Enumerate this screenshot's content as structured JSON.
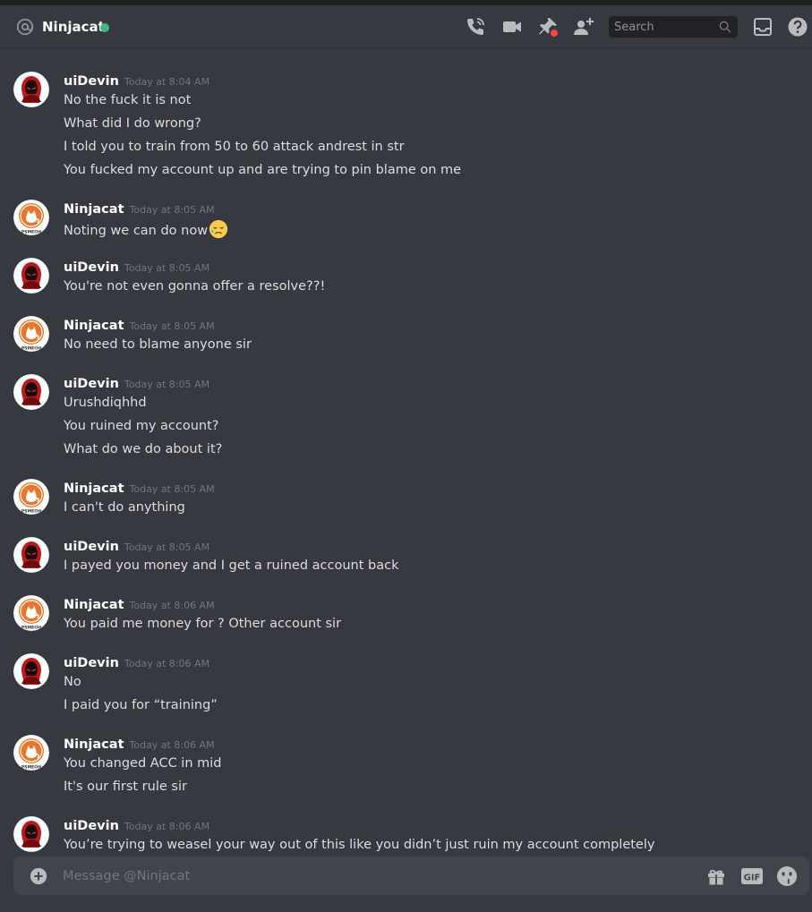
{
  "header": {
    "channel_name": "Ninjacat",
    "status_color": "#43b581",
    "search_placeholder": "Search",
    "icons": [
      "call-icon",
      "video-icon",
      "pin-icon",
      "add-friend-icon",
      "search-icon",
      "inbox-icon",
      "help-icon"
    ]
  },
  "composer": {
    "placeholder": "Message @Ninjacat",
    "icons": [
      "attach-icon",
      "gift-icon",
      "gif-icon",
      "emoji-icon"
    ],
    "gif_label": "GIF"
  },
  "messages": [
    {
      "author": "uiDevin",
      "time": "Today at 8:04 AM",
      "lines": [
        "No the fuck it is not",
        "What did I do wrong?",
        "I told you to train from 50 to 60 attack andrest  in str",
        "You fucked my account up and are trying to pin blame on me"
      ]
    },
    {
      "author": "Ninjacat",
      "time": "Today at 8:05 AM",
      "lines": [
        "Noting we can do now"
      ],
      "emoji": "sad-relieved-face-icon"
    },
    {
      "author": "uiDevin",
      "time": "Today at 8:05 AM",
      "lines": [
        "You're not even gonna offer a resolve??!"
      ]
    },
    {
      "author": "Ninjacat",
      "time": "Today at 8:05 AM",
      "lines": [
        "No need to blame anyone sir"
      ]
    },
    {
      "author": "uiDevin",
      "time": "Today at 8:05 AM",
      "lines": [
        "Urushdiqhhd",
        "You ruined my account?",
        "What do we do about it?"
      ]
    },
    {
      "author": "Ninjacat",
      "time": "Today at 8:05 AM",
      "lines": [
        "I can't do anything"
      ]
    },
    {
      "author": "uiDevin",
      "time": "Today at 8:05 AM",
      "lines": [
        "I payed you money and I get a ruined account back"
      ]
    },
    {
      "author": "Ninjacat",
      "time": "Today at 8:06 AM",
      "lines": [
        "You paid me money for ? Other account sir"
      ]
    },
    {
      "author": "uiDevin",
      "time": "Today at 8:06 AM",
      "lines": [
        "No",
        "I paid you for “training”"
      ]
    },
    {
      "author": "Ninjacat",
      "time": "Today at 8:06 AM",
      "lines": [
        "You changed ACC in mid",
        "It's our first rule sir"
      ]
    },
    {
      "author": "uiDevin",
      "time": "Today at 8:06 AM",
      "lines": [
        "You’re trying to weasel your way out of this like you didn’t just ruin my account completely"
      ]
    }
  ],
  "avatar_text": {
    "ninjacat": "PSMEOH"
  },
  "colors": {
    "background": "#36393f",
    "composer": "#40444b",
    "online": "#43b581",
    "ninjacat_orange": "#e8762c",
    "devin_red": "#c0171b"
  }
}
